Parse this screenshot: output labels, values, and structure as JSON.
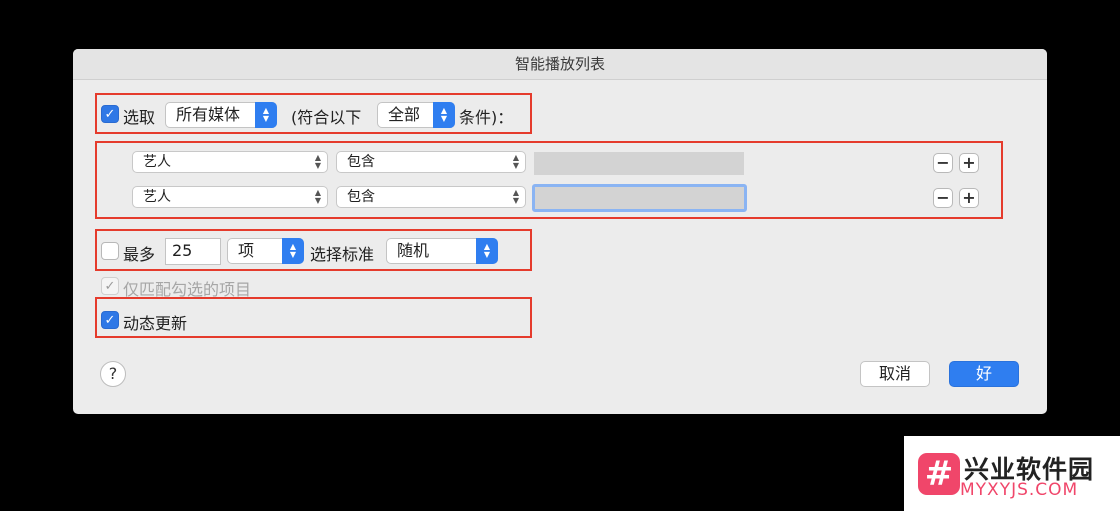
{
  "dialog": {
    "title": "智能播放列表",
    "select_row": {
      "checked": true,
      "label": "选取",
      "media_popup": "所有媒体",
      "match_prefix": "(符合以下",
      "match_popup": "全部",
      "match_suffix": "条件)："
    },
    "rules": [
      {
        "field": "艺人",
        "operator": "包含",
        "value": "",
        "focused": false
      },
      {
        "field": "艺人",
        "operator": "包含",
        "value": "",
        "focused": true
      }
    ],
    "limit_row": {
      "checked": false,
      "label": "最多",
      "count": "25",
      "unit_popup": "项",
      "criteria_label": "选择标准",
      "criteria_popup": "随机"
    },
    "checked_only": {
      "checked": true,
      "label": "仅匹配勾选的项目",
      "enabled": false
    },
    "live_update": {
      "checked": true,
      "label": "动态更新"
    },
    "minus_label": "−",
    "plus_label": "+",
    "help_label": "?",
    "cancel_label": "取消",
    "ok_label": "好"
  },
  "watermark": {
    "logo_glyph": "#",
    "title": "兴业软件园",
    "url": "MYXYJS.COM"
  },
  "colors": {
    "accent": "#2f7ef0",
    "highlight_box": "#e53b2c",
    "watermark": "#f0466a"
  }
}
